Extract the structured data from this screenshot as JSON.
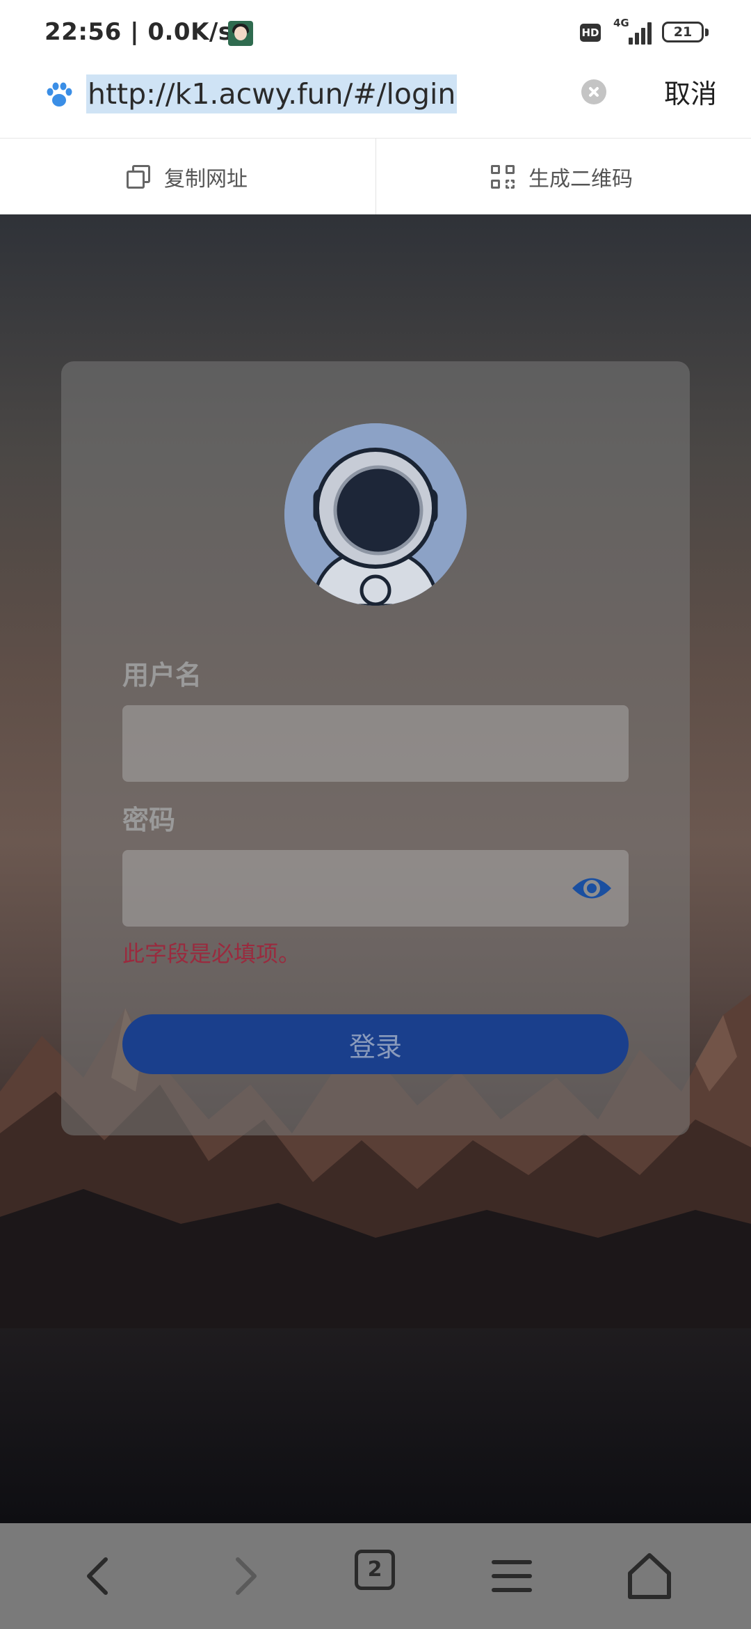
{
  "status_bar": {
    "time": "22:56",
    "network_speed": "0.0K/s",
    "hd_label": "HD",
    "network_type": "4G",
    "battery": "21"
  },
  "address_bar": {
    "url": "http://k1.acwy.fun/#/login",
    "cancel_label": "取消"
  },
  "actions": {
    "copy_label": "复制网址",
    "qr_label": "生成二维码"
  },
  "login": {
    "username_label": "用户名",
    "password_label": "密码",
    "error_message": "此字段是必填项。",
    "login_button": "登录"
  },
  "bottom_nav": {
    "tab_count": "2"
  },
  "colors": {
    "accent": "#1a3f8c",
    "error": "#9a2a3e",
    "url_highlight": "#cfe3f5"
  }
}
